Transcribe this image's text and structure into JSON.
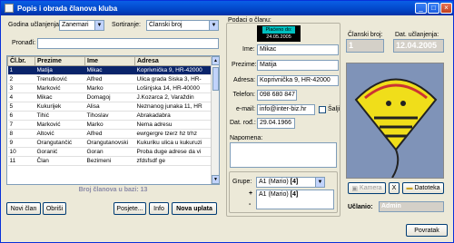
{
  "window": {
    "title": "Popis i obrada članova kluba"
  },
  "filters": {
    "membership_year_label": "Godina učlanjenja:",
    "membership_year_value": "Zanemari",
    "sort_label": "Sortiranje:",
    "sort_value": "Članski broj",
    "find_label": "Pronađi:",
    "find_value": ""
  },
  "table": {
    "headers": [
      "Čl.br.",
      "Prezime",
      "Ime",
      "Adresa"
    ],
    "rows": [
      [
        "1",
        "Matija",
        "Mikac",
        "Koprivnička 9, HR-42000"
      ],
      [
        "2",
        "Trenutković",
        "Alfred",
        "Ulica grada Siska 3, HR-"
      ],
      [
        "3",
        "Marković",
        "Marko",
        "Lošinjska 14, HR-40000"
      ],
      [
        "4",
        "Mikac",
        "Domagoj",
        "J.Kozarca 2, Varaždin"
      ],
      [
        "5",
        "Kukurijek",
        "Alisa",
        "Neznanog junaka 11, HR"
      ],
      [
        "6",
        "Tihić",
        "Tihoslav",
        "Abrakadabra"
      ],
      [
        "7",
        "Marković",
        "Marko",
        "Nema adresu"
      ],
      [
        "8",
        "Altović",
        "Alfred",
        "ewrgergre tzerz hz trhz"
      ],
      [
        "9",
        "Orangutančić",
        "Orangutanovski",
        "Kukuriku ulica u kukuruzi"
      ],
      [
        "10",
        "Goranić",
        "Goran",
        "Proba duge adrese da vi"
      ],
      [
        "11",
        "Član",
        "Bezimeni",
        "zfdsfsdf ge"
      ]
    ],
    "selected_index": 0
  },
  "footer_count": "Broj članova u bazi: 13",
  "buttons": {
    "new_member": "Novi član",
    "delete": "Obriši",
    "visits": "Posjete...",
    "info": "Info",
    "new_payment": "Nova uplata",
    "close": "Povratak"
  },
  "details": {
    "group_label": "Podaci o članu:",
    "paid_label": "Plaćeno do:",
    "paid_date": "24.05.2005",
    "name_label": "Ime:",
    "name_value": "Mikac",
    "surname_label": "Prezime:",
    "surname_value": "Matija",
    "address_label": "Adresa:",
    "address_value": "Koprivnička 9, HR-42000",
    "phone_label": "Telefon:",
    "phone_value": "098 680 847",
    "email_label": "e-mail:",
    "email_value": "info@inter-biz.hr",
    "send_label": "Šalji",
    "birth_label": "Dat. rođ.:",
    "birth_value": "29.04.1966",
    "note_label": "Napomena:",
    "note_value": "",
    "groups_label": "Grupe:",
    "groups_select": "A1 (Mario)",
    "groups_select_bold": "[4]",
    "group_item_prefix": "A1 (Mario)",
    "group_item_bold": "[4]",
    "plus": "+",
    "minus": "-"
  },
  "member": {
    "number_label": "Članski broj:",
    "number_value": "1",
    "joined_label": "Dat. učlanjenja:",
    "joined_value": "12.04.2005",
    "camera_label": "Kamera",
    "file_label": "Datoteka",
    "remove_label": "X",
    "registered_by_label": "Učlanio:",
    "registered_by_value": "Admin"
  },
  "colors": {
    "title_bar": "#0246c8",
    "selection": "#0a246a",
    "paid_box": "#00c0c0"
  }
}
